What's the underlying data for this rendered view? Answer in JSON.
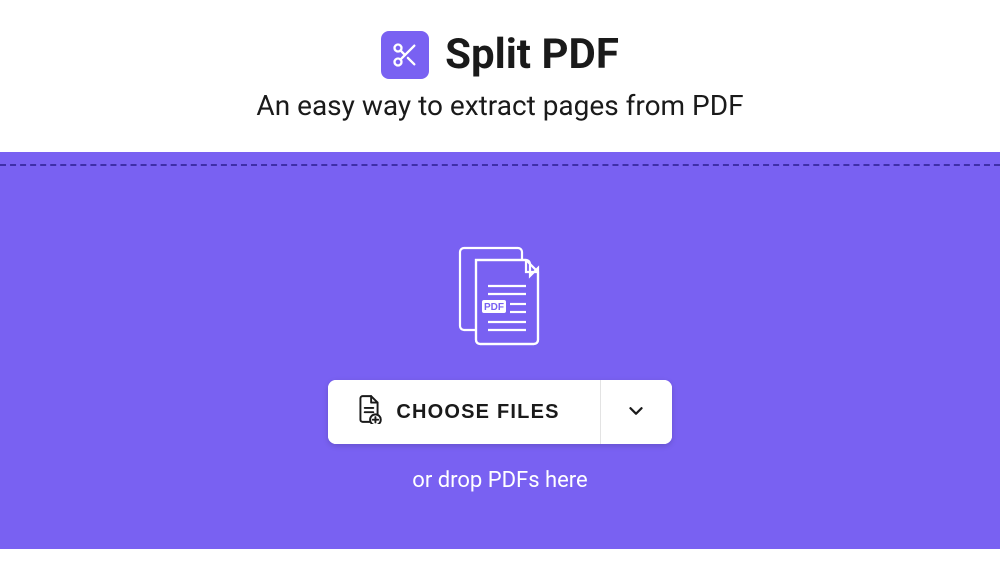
{
  "header": {
    "title": "Split PDF",
    "subtitle": "An easy way to extract pages from PDF"
  },
  "dropzone": {
    "choose_label": "CHOOSE FILES",
    "drop_hint": "or drop PDFs here",
    "file_type_badge": "PDF"
  }
}
